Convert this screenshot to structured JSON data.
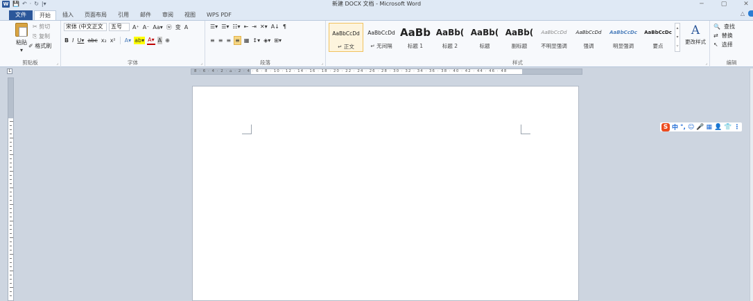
{
  "window": {
    "title": "新建 DOCX 文档 - Microsoft Word",
    "app_icon_letter": "W",
    "qat": [
      "💾",
      "↶",
      "·",
      "↻",
      "|▾"
    ],
    "controls": [
      "─",
      "▢",
      "✕"
    ]
  },
  "tabs": [
    "文件",
    "开始",
    "插入",
    "页面布局",
    "引用",
    "邮件",
    "审阅",
    "视图",
    "WPS PDF"
  ],
  "ribbon_collapse": "△",
  "clipboard": {
    "paste_label": "粘贴",
    "paste_arrow": "▾",
    "cut": "✂ 剪切",
    "copy": "⎘ 复制",
    "format_painter": "✐ 格式刷",
    "group_label": "剪贴板"
  },
  "font": {
    "font_name": "宋体 (中文正文",
    "font_size": "五号",
    "row1": [
      "A⁺",
      "A⁻",
      "Aa▾",
      "ⓦ",
      "变",
      "A"
    ],
    "row2": [
      "B",
      "I",
      "U▾",
      "abc",
      "x₂",
      "x²",
      "A▾",
      "ab▾",
      "A▾",
      "A",
      "⊕"
    ],
    "group_label": "字体"
  },
  "paragraph": {
    "row1": [
      "☰▾",
      "☰▾",
      "☷▾",
      "⇤",
      "⇥",
      "✕▾",
      "A↓",
      "¶"
    ],
    "row2": [
      "≡",
      "≡",
      "≡",
      "≡",
      "▦",
      "↕▾",
      "◈▾",
      "⊞▾"
    ],
    "group_label": "段落"
  },
  "styles": {
    "items": [
      {
        "sample": "AaBbCcDd",
        "name": "↵ 正文"
      },
      {
        "sample": "AaBbCcDd",
        "name": "↵ 无间隔"
      },
      {
        "sample": "AaBb",
        "name": "标题 1"
      },
      {
        "sample": "AaBb(",
        "name": "标题 2"
      },
      {
        "sample": "AaBb(",
        "name": "标题"
      },
      {
        "sample": "AaBb(",
        "name": "副标题"
      },
      {
        "sample": "AaBbCcDd",
        "name": "不明显强调"
      },
      {
        "sample": "AaBbCcDd",
        "name": "强调"
      },
      {
        "sample": "AaBbCcDc",
        "name": "明显强调"
      },
      {
        "sample": "AaBbCcDc",
        "name": "要点"
      }
    ],
    "change_styles": "更改样式",
    "change_icon": "A",
    "group_label": "样式"
  },
  "editing": {
    "find": "查找",
    "replace": "替换",
    "select": "选择",
    "group_label": "编辑"
  },
  "ruler": {
    "corner": "L",
    "ticks": "8 · 6 · 4 · 2 · ⌂ · 2 · 4 · 6 · 8 · 10 · 12 · 14 · 16 · 18 · 20 · 22 · 24 · 26 · 28 · 30 · 32 · 34 · 36 · 38 · 40 · 42 · 44 · 46 · 48"
  },
  "ime": {
    "logo": "S",
    "lang": "中",
    "icons": [
      "°,",
      "☺",
      "🎤",
      "▦",
      "👤",
      "👕",
      "⋮"
    ]
  },
  "colors": {
    "word_blue": "#2b579a",
    "ribbon_bg": "#f7f9fc",
    "app_bg": "#cdd5e0",
    "style_selected_border": "#f1c15d",
    "heading_blue": "#17365d",
    "emphasis_blue": "#4f81bd",
    "ime_orange": "#ec4b1e"
  }
}
